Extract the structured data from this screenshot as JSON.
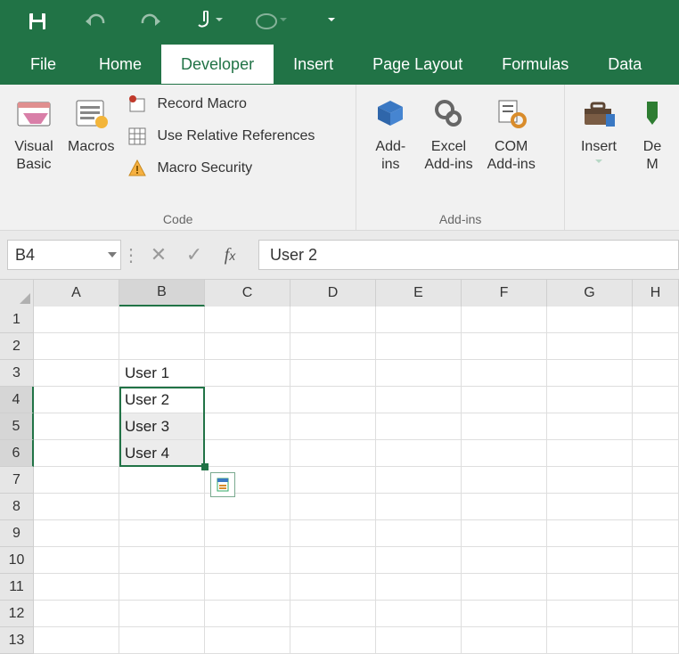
{
  "qat": {
    "save": "Save",
    "undo": "Undo",
    "redo": "Redo",
    "touch": "Touch/Mouse Mode"
  },
  "tabs": {
    "file": "File",
    "home": "Home",
    "developer": "Developer",
    "insert": "Insert",
    "page_layout": "Page Layout",
    "formulas": "Formulas",
    "data": "Data"
  },
  "ribbon": {
    "vb": "Visual\nBasic",
    "macros": "Macros",
    "record_macro": "Record Macro",
    "use_rel": "Use Relative References",
    "macro_sec": "Macro Security",
    "group_code": "Code",
    "addins": "Add-\nins",
    "excel_addins": "Excel\nAdd-ins",
    "com_addins": "COM\nAdd-ins",
    "group_addins": "Add-ins",
    "insert": "Insert",
    "design": "De\nM"
  },
  "namebox": "B4",
  "formula": "User 2",
  "columns": [
    "A",
    "B",
    "C",
    "D",
    "E",
    "F",
    "G",
    "H"
  ],
  "rows": [
    "1",
    "2",
    "3",
    "4",
    "5",
    "6",
    "7",
    "8",
    "9",
    "10",
    "11",
    "12",
    "13"
  ],
  "cells": {
    "B3": "User 1",
    "B4": "User 2",
    "B5": "User 3",
    "B6": "User 4"
  },
  "selection": {
    "col": "B",
    "rowStart": 4,
    "rowEnd": 6
  }
}
